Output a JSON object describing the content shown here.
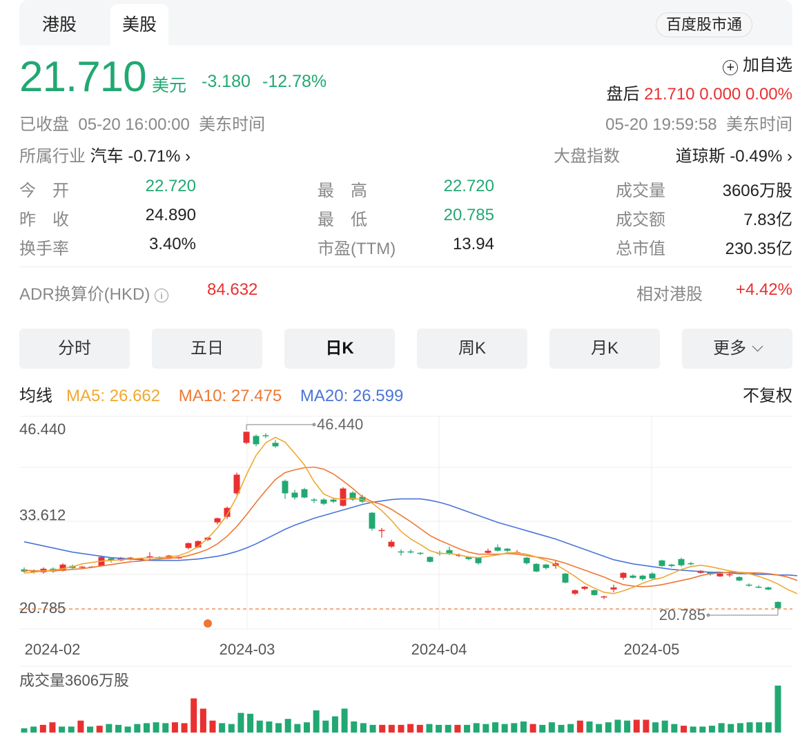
{
  "tabs": [
    {
      "label": "港股"
    },
    {
      "label": "美股"
    }
  ],
  "broker_button": "百度股市通",
  "price": "21.710",
  "currency": "美元",
  "change": "-3.180",
  "change_pct": "-12.78%",
  "watchlist": {
    "icon": "plus-circle-icon",
    "label": "加自选"
  },
  "after_hours": {
    "label": "盘后",
    "price": "21.710",
    "change": "0.000",
    "pct": "0.00%"
  },
  "status": {
    "state": "已收盘",
    "time": "05-20 16:00:00",
    "tz": "美东时间"
  },
  "after_time": {
    "time": "05-20 19:59:58",
    "tz": "美东时间"
  },
  "industry": {
    "label": "所属行业",
    "name": "汽车",
    "pct": "-0.71%"
  },
  "index": {
    "label": "大盘指数",
    "name": "道琼斯",
    "pct": "-0.49%"
  },
  "stats": [
    [
      {
        "label": "今　开",
        "value": "22.720",
        "color": "green"
      },
      {
        "label": "最　高",
        "value": "22.720",
        "color": "green"
      },
      {
        "label": "成交量",
        "value": "3606万股",
        "color": "black"
      }
    ],
    [
      {
        "label": "昨　收",
        "value": "24.890",
        "color": "black"
      },
      {
        "label": "最　低",
        "value": "20.785",
        "color": "green"
      },
      {
        "label": "成交额",
        "value": "7.83亿",
        "color": "black"
      }
    ],
    [
      {
        "label": "换手率",
        "value": "3.40%",
        "color": "black"
      },
      {
        "label": "市盈(TTM)",
        "value": "13.94",
        "color": "black"
      },
      {
        "label": "总市值",
        "value": "230.35亿",
        "color": "black"
      }
    ]
  ],
  "adr": {
    "label": "ADR换算价(HKD)",
    "value": "84.632",
    "rel_label": "相对港股",
    "rel_value": "+4.42%"
  },
  "periods": [
    {
      "label": "分时"
    },
    {
      "label": "五日"
    },
    {
      "label": "日K"
    },
    {
      "label": "周K"
    },
    {
      "label": "月K"
    },
    {
      "label": "更多"
    }
  ],
  "ma": {
    "label": "均线",
    "ma5": "MA5: 26.662",
    "ma10": "MA10: 27.475",
    "ma20": "MA20: 26.599",
    "adjust": "不复权"
  },
  "colors": {
    "up": "#e93030",
    "down": "#22a872",
    "ma5": "#f0a830",
    "ma10": "#ee7733",
    "ma20": "#4a74d8"
  },
  "chart_data": {
    "type": "candlestick",
    "y_labels": [
      "46.440",
      "33.612",
      "20.785"
    ],
    "x_labels": [
      "2024-02",
      "2024-03",
      "2024-04",
      "2024-05"
    ],
    "max_label": "46.440",
    "min_label": "20.785",
    "ylim": [
      20.785,
      46.44
    ],
    "candles": [
      {
        "o": 26.5,
        "c": 26.2,
        "h": 26.8,
        "l": 26.0
      },
      {
        "o": 26.3,
        "c": 26.1,
        "h": 26.5,
        "l": 25.9
      },
      {
        "o": 26.1,
        "c": 26.6,
        "h": 26.8,
        "l": 25.9
      },
      {
        "o": 26.6,
        "c": 26.2,
        "h": 26.8,
        "l": 26.0
      },
      {
        "o": 26.3,
        "c": 27.2,
        "h": 27.4,
        "l": 26.2
      },
      {
        "o": 27.0,
        "c": 26.7,
        "h": 27.2,
        "l": 26.6
      },
      {
        "o": 26.8,
        "c": 26.9,
        "h": 27.0,
        "l": 26.7
      },
      {
        "o": 26.8,
        "c": 26.9,
        "h": 27.0,
        "l": 26.7
      },
      {
        "o": 27.0,
        "c": 28.3,
        "h": 28.5,
        "l": 27.0
      },
      {
        "o": 28.1,
        "c": 27.8,
        "h": 28.2,
        "l": 27.5
      },
      {
        "o": 27.8,
        "c": 28.2,
        "h": 28.3,
        "l": 27.7
      },
      {
        "o": 27.9,
        "c": 28.2,
        "h": 28.3,
        "l": 27.8
      },
      {
        "o": 27.9,
        "c": 28.1,
        "h": 28.2,
        "l": 27.8
      },
      {
        "o": 28.4,
        "c": 28.4,
        "h": 29.0,
        "l": 28.0
      },
      {
        "o": 28.3,
        "c": 28.1,
        "h": 28.4,
        "l": 27.9
      },
      {
        "o": 28.1,
        "c": 28.5,
        "h": 28.6,
        "l": 28.0
      },
      {
        "o": 28.1,
        "c": 28.3,
        "h": 28.4,
        "l": 28.0
      },
      {
        "o": 29.6,
        "c": 30.3,
        "h": 30.4,
        "l": 29.4
      },
      {
        "o": 29.7,
        "c": 30.6,
        "h": 30.7,
        "l": 29.6
      },
      {
        "o": 30.8,
        "c": 31.1,
        "h": 31.2,
        "l": 30.6
      },
      {
        "o": 33.3,
        "c": 33.9,
        "h": 34.0,
        "l": 33.0
      },
      {
        "o": 34.1,
        "c": 35.4,
        "h": 35.6,
        "l": 33.8
      },
      {
        "o": 37.5,
        "c": 40.2,
        "h": 40.5,
        "l": 37.3
      },
      {
        "o": 44.8,
        "c": 46.4,
        "h": 46.44,
        "l": 44.6
      },
      {
        "o": 45.8,
        "c": 44.6,
        "h": 46.0,
        "l": 44.3
      },
      {
        "o": 45.9,
        "c": 45.8,
        "h": 46.2,
        "l": 45.5
      },
      {
        "o": 44.8,
        "c": 44.3,
        "h": 45.2,
        "l": 44.1
      },
      {
        "o": 39.3,
        "c": 37.5,
        "h": 39.5,
        "l": 36.7
      },
      {
        "o": 37.6,
        "c": 36.9,
        "h": 38.0,
        "l": 36.6
      },
      {
        "o": 38.1,
        "c": 36.9,
        "h": 38.3,
        "l": 36.8
      },
      {
        "o": 36.6,
        "c": 36.5,
        "h": 36.8,
        "l": 36.1
      },
      {
        "o": 36.6,
        "c": 36.0,
        "h": 36.8,
        "l": 35.8
      },
      {
        "o": 36.6,
        "c": 36.3,
        "h": 36.9,
        "l": 36.1
      },
      {
        "o": 35.7,
        "c": 38.2,
        "h": 38.4,
        "l": 35.6
      },
      {
        "o": 37.6,
        "c": 36.6,
        "h": 37.8,
        "l": 36.4
      },
      {
        "o": 37.0,
        "c": 36.3,
        "h": 37.3,
        "l": 36.1
      },
      {
        "o": 34.7,
        "c": 32.4,
        "h": 34.8,
        "l": 32.1
      },
      {
        "o": 32.2,
        "c": 32.2,
        "h": 32.5,
        "l": 31.1
      },
      {
        "o": 29.8,
        "c": 30.5,
        "h": 30.8,
        "l": 29.6
      },
      {
        "o": 29.1,
        "c": 29.0,
        "h": 29.4,
        "l": 28.5
      },
      {
        "o": 29.1,
        "c": 29.0,
        "h": 29.4,
        "l": 28.8
      },
      {
        "o": 28.9,
        "c": 28.8,
        "h": 29.0,
        "l": 28.6
      },
      {
        "o": 28.3,
        "c": 27.6,
        "h": 28.4,
        "l": 27.5
      },
      {
        "o": 28.9,
        "c": 28.8,
        "h": 29.2,
        "l": 28.5
      },
      {
        "o": 29.3,
        "c": 28.7,
        "h": 29.8,
        "l": 28.6
      },
      {
        "o": 28.6,
        "c": 28.6,
        "h": 28.8,
        "l": 28.3
      },
      {
        "o": 28.3,
        "c": 28.0,
        "h": 28.4,
        "l": 27.8
      },
      {
        "o": 28.2,
        "c": 27.4,
        "h": 28.3,
        "l": 27.2
      },
      {
        "o": 28.9,
        "c": 29.2,
        "h": 29.5,
        "l": 28.8
      },
      {
        "o": 29.7,
        "c": 29.2,
        "h": 30.1,
        "l": 29.1
      },
      {
        "o": 29.5,
        "c": 29.2,
        "h": 29.6,
        "l": 29.0
      },
      {
        "o": 29.0,
        "c": 29.0,
        "h": 29.3,
        "l": 28.7
      },
      {
        "o": 28.2,
        "c": 27.4,
        "h": 28.3,
        "l": 27.2
      },
      {
        "o": 27.3,
        "c": 26.2,
        "h": 27.4,
        "l": 26.1
      },
      {
        "o": 27.2,
        "c": 26.7,
        "h": 27.3,
        "l": 26.5
      },
      {
        "o": 27.0,
        "c": 27.4,
        "h": 27.7,
        "l": 26.6
      },
      {
        "o": 25.9,
        "c": 24.6,
        "h": 26.0,
        "l": 24.5
      },
      {
        "o": 23.0,
        "c": 23.5,
        "h": 23.6,
        "l": 22.8
      },
      {
        "o": 23.7,
        "c": 24.0,
        "h": 24.1,
        "l": 23.5
      },
      {
        "o": 23.5,
        "c": 22.8,
        "h": 23.6,
        "l": 22.7
      },
      {
        "o": 22.6,
        "c": 22.6,
        "h": 22.7,
        "l": 22.2
      },
      {
        "o": 23.6,
        "c": 23.9,
        "h": 24.3,
        "l": 23.2
      },
      {
        "o": 25.3,
        "c": 26.0,
        "h": 26.1,
        "l": 25.0
      },
      {
        "o": 25.6,
        "c": 25.3,
        "h": 25.8,
        "l": 25.2
      },
      {
        "o": 25.6,
        "c": 25.1,
        "h": 25.7,
        "l": 24.9
      },
      {
        "o": 25.9,
        "c": 25.2,
        "h": 26.1,
        "l": 25.1
      },
      {
        "o": 27.8,
        "c": 27.0,
        "h": 27.9,
        "l": 26.9
      },
      {
        "o": 27.2,
        "c": 27.0,
        "h": 27.3,
        "l": 26.8
      },
      {
        "o": 28.0,
        "c": 27.1,
        "h": 28.2,
        "l": 26.9
      },
      {
        "o": 27.4,
        "c": 27.3,
        "h": 27.6,
        "l": 27.1
      },
      {
        "o": 26.0,
        "c": 26.3,
        "h": 26.4,
        "l": 25.9
      },
      {
        "o": 26.1,
        "c": 25.8,
        "h": 26.2,
        "l": 25.6
      },
      {
        "o": 25.5,
        "c": 25.9,
        "h": 26.0,
        "l": 25.4
      },
      {
        "o": 25.8,
        "c": 25.8,
        "h": 26.2,
        "l": 25.4
      },
      {
        "o": 25.4,
        "c": 24.9,
        "h": 25.5,
        "l": 24.8
      },
      {
        "o": 24.3,
        "c": 24.2,
        "h": 24.5,
        "l": 24.0
      },
      {
        "o": 24.0,
        "c": 23.9,
        "h": 24.2,
        "l": 23.8
      },
      {
        "o": 23.9,
        "c": 23.6,
        "h": 24.0,
        "l": 23.5
      },
      {
        "o": 21.8,
        "c": 20.9,
        "h": 21.9,
        "l": 20.785
      }
    ],
    "ma5": [
      26.0,
      26.1,
      26.3,
      26.4,
      26.6,
      26.9,
      27.3,
      27.5,
      27.7,
      27.8,
      27.9,
      28.0,
      28.1,
      28.2,
      28.2,
      28.3,
      28.5,
      29.0,
      29.8,
      31.0,
      32.5,
      34.4,
      37.0,
      40.2,
      43.0,
      44.8,
      45.6,
      44.9,
      43.3,
      41.6,
      39.2,
      37.4,
      36.8,
      36.6,
      36.8,
      36.6,
      36.1,
      35.0,
      33.6,
      32.0,
      30.9,
      30.1,
      29.2,
      28.8,
      28.8,
      28.6,
      28.3,
      28.2,
      28.4,
      28.6,
      28.9,
      28.9,
      28.7,
      28.3,
      27.8,
      27.2,
      26.4,
      25.5,
      24.5,
      23.8,
      23.2,
      23.0,
      23.4,
      23.9,
      24.5,
      25.0,
      25.3,
      25.9,
      26.5,
      26.9,
      27.1,
      26.9,
      26.6,
      26.3,
      26.1,
      25.9,
      25.5,
      25.0,
      24.4,
      23.6,
      23.0
    ],
    "ma10": [
      26.4,
      26.3,
      26.3,
      26.3,
      26.4,
      26.5,
      26.6,
      26.8,
      27.0,
      27.2,
      27.4,
      27.6,
      27.7,
      27.9,
      28.0,
      28.1,
      28.2,
      28.5,
      28.9,
      29.4,
      30.2,
      31.3,
      32.7,
      34.4,
      36.2,
      37.9,
      39.5,
      40.5,
      40.9,
      41.2,
      41.3,
      41.0,
      40.3,
      39.3,
      38.2,
      37.0,
      36.3,
      35.9,
      35.2,
      34.3,
      33.4,
      32.4,
      31.4,
      30.7,
      30.1,
      29.5,
      29.0,
      28.7,
      28.7,
      28.7,
      28.8,
      28.7,
      28.5,
      28.3,
      28.1,
      27.8,
      27.4,
      26.9,
      26.4,
      25.9,
      25.4,
      24.8,
      24.3,
      24.1,
      24.0,
      24.1,
      24.3,
      24.6,
      24.9,
      25.2,
      25.6,
      25.9,
      26.0,
      26.1,
      26.1,
      26.0,
      26.0,
      25.9,
      25.7,
      25.4,
      24.9
    ],
    "ma20": [
      30.5,
      30.2,
      29.9,
      29.6,
      29.3,
      29.0,
      28.8,
      28.6,
      28.4,
      28.2,
      28.1,
      28.0,
      27.9,
      27.8,
      27.8,
      27.8,
      27.8,
      27.9,
      28.0,
      28.2,
      28.4,
      28.7,
      29.1,
      29.6,
      30.2,
      30.9,
      31.6,
      32.3,
      32.9,
      33.4,
      33.9,
      34.3,
      34.7,
      35.1,
      35.5,
      35.9,
      36.2,
      36.4,
      36.6,
      36.7,
      36.7,
      36.7,
      36.5,
      36.2,
      35.8,
      35.3,
      34.8,
      34.3,
      33.8,
      33.3,
      32.9,
      32.5,
      32.1,
      31.7,
      31.3,
      30.9,
      30.4,
      29.9,
      29.4,
      28.9,
      28.4,
      27.9,
      27.6,
      27.3,
      27.1,
      26.9,
      26.7,
      26.5,
      26.4,
      26.3,
      26.2,
      26.1,
      26.1,
      26.0,
      25.9,
      25.9,
      25.8,
      25.8,
      25.7,
      25.7,
      25.6
    ],
    "volume_label": "成交量3606万股",
    "volumes": [
      {
        "v": 5,
        "d": "down"
      },
      {
        "v": 7,
        "d": "down"
      },
      {
        "v": 9,
        "d": "up"
      },
      {
        "v": 12,
        "d": "up"
      },
      {
        "v": 7,
        "d": "down"
      },
      {
        "v": 7,
        "d": "down"
      },
      {
        "v": 14,
        "d": "up"
      },
      {
        "v": 7,
        "d": "down"
      },
      {
        "v": 8,
        "d": "up"
      },
      {
        "v": 10,
        "d": "down"
      },
      {
        "v": 9,
        "d": "down"
      },
      {
        "v": 7,
        "d": "down"
      },
      {
        "v": 10,
        "d": "down"
      },
      {
        "v": 11,
        "d": "down"
      },
      {
        "v": 12,
        "d": "down"
      },
      {
        "v": 11,
        "d": "down"
      },
      {
        "v": 12,
        "d": "up"
      },
      {
        "v": 11,
        "d": "up"
      },
      {
        "v": 40,
        "d": "up"
      },
      {
        "v": 28,
        "d": "up"
      },
      {
        "v": 14,
        "d": "up"
      },
      {
        "v": 11,
        "d": "down"
      },
      {
        "v": 10,
        "d": "down"
      },
      {
        "v": 23,
        "d": "down"
      },
      {
        "v": 22,
        "d": "down"
      },
      {
        "v": 14,
        "d": "down"
      },
      {
        "v": 13,
        "d": "down"
      },
      {
        "v": 11,
        "d": "down"
      },
      {
        "v": 16,
        "d": "down"
      },
      {
        "v": 10,
        "d": "down"
      },
      {
        "v": 12,
        "d": "down"
      },
      {
        "v": 26,
        "d": "down"
      },
      {
        "v": 14,
        "d": "down"
      },
      {
        "v": 19,
        "d": "down"
      },
      {
        "v": 28,
        "d": "down"
      },
      {
        "v": 13,
        "d": "down"
      },
      {
        "v": 11,
        "d": "down"
      },
      {
        "v": 9,
        "d": "down"
      },
      {
        "v": 9,
        "d": "up"
      },
      {
        "v": 9,
        "d": "up"
      },
      {
        "v": 9,
        "d": "up"
      },
      {
        "v": 10,
        "d": "up"
      },
      {
        "v": 9,
        "d": "up"
      },
      {
        "v": 10,
        "d": "down"
      },
      {
        "v": 9,
        "d": "down"
      },
      {
        "v": 9,
        "d": "down"
      },
      {
        "v": 9,
        "d": "up"
      },
      {
        "v": 9,
        "d": "down"
      },
      {
        "v": 11,
        "d": "down"
      },
      {
        "v": 10,
        "d": "down"
      },
      {
        "v": 12,
        "d": "down"
      },
      {
        "v": 10,
        "d": "down"
      },
      {
        "v": 11,
        "d": "down"
      },
      {
        "v": 13,
        "d": "down"
      },
      {
        "v": 10,
        "d": "up"
      },
      {
        "v": 9,
        "d": "down"
      },
      {
        "v": 12,
        "d": "down"
      },
      {
        "v": 9,
        "d": "down"
      },
      {
        "v": 10,
        "d": "down"
      },
      {
        "v": 14,
        "d": "up"
      },
      {
        "v": 13,
        "d": "down"
      },
      {
        "v": 10,
        "d": "down"
      },
      {
        "v": 12,
        "d": "down"
      },
      {
        "v": 15,
        "d": "down"
      },
      {
        "v": 14,
        "d": "down"
      },
      {
        "v": 15,
        "d": "up"
      },
      {
        "v": 15,
        "d": "up"
      },
      {
        "v": 12,
        "d": "down"
      },
      {
        "v": 14,
        "d": "down"
      },
      {
        "v": 10,
        "d": "down"
      },
      {
        "v": 8,
        "d": "up"
      },
      {
        "v": 7,
        "d": "down"
      },
      {
        "v": 7,
        "d": "down"
      },
      {
        "v": 8,
        "d": "down"
      },
      {
        "v": 11,
        "d": "down"
      },
      {
        "v": 10,
        "d": "down"
      },
      {
        "v": 11,
        "d": "down"
      },
      {
        "v": 12,
        "d": "down"
      },
      {
        "v": 12,
        "d": "down"
      },
      {
        "v": 12,
        "d": "down"
      },
      {
        "v": 55,
        "d": "down"
      }
    ]
  }
}
